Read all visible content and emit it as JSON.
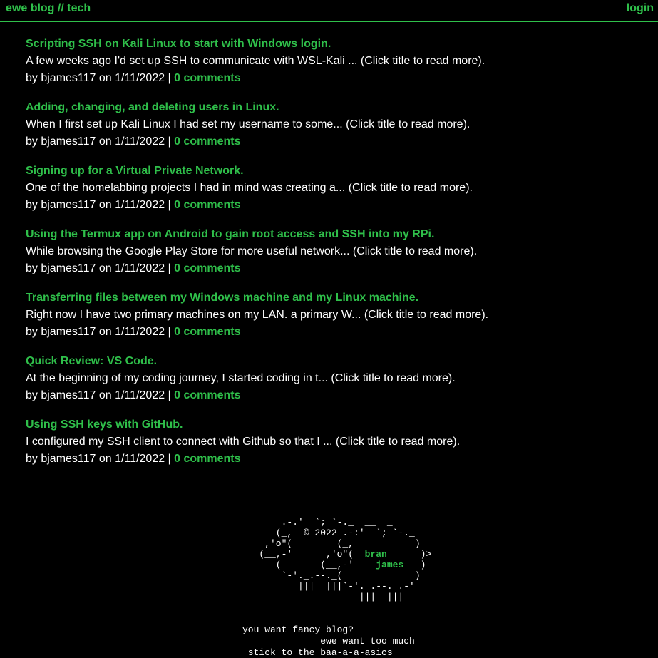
{
  "header": {
    "site_title": "ewe blog // tech",
    "login_label": "login"
  },
  "posts": [
    {
      "title": "Scripting SSH on Kali Linux to start with Windows login.",
      "excerpt": "A few weeks ago I'd set up SSH to communicate with WSL-Kali ... (Click title to read more).",
      "meta": "by bjames117 on 1/11/2022 | ",
      "comments": "0 comments"
    },
    {
      "title": "Adding, changing, and deleting users in Linux.",
      "excerpt": "When I first set up Kali Linux I had set my username to some... (Click title to read more).",
      "meta": "by bjames117 on 1/11/2022 | ",
      "comments": "0 comments"
    },
    {
      "title": "Signing up for a Virtual Private Network.",
      "excerpt": "One of the homelabbing projects I had in mind was creating a... (Click title to read more).",
      "meta": "by bjames117 on 1/11/2022 | ",
      "comments": "0 comments"
    },
    {
      "title": "Using the Termux app on Android to gain root access and SSH into my RPi.",
      "excerpt": "While browsing the Google Play Store for more useful network... (Click title to read more).",
      "meta": "by bjames117 on 1/11/2022 | ",
      "comments": "0 comments"
    },
    {
      "title": "Transferring files between my Windows machine and my Linux machine.",
      "excerpt": "Right now I have two primary machines on my LAN. a primary W... (Click title to read more).",
      "meta": "by bjames117 on 1/11/2022 | ",
      "comments": "0 comments"
    },
    {
      "title": "Quick Review: VS Code.",
      "excerpt": "At the beginning of my coding journey, I started coding in t... (Click title to read more).",
      "meta": "by bjames117 on 1/11/2022 | ",
      "comments": "0 comments"
    },
    {
      "title": "Using SSH keys with GitHub.",
      "excerpt": "I configured my SSH client to connect with Github so that I ... (Click title to read more).",
      "meta": "by bjames117 on 1/11/2022 | ",
      "comments": "0 comments"
    }
  ],
  "footer": {
    "ascii_lines": [
      "           __  _",
      "       .-.'  `; `-._  __  _",
      "      (_,  © 2022 .-:'  `; `-._",
      "    ,'o\"(        (_,           )",
      "   (__,-'      ,'o\"(  ",
      "      (       (__,-'    ",
      "       `-'._.--._(             )",
      "          |||  |||`-'._.--._.-'",
      "                     |||  |||"
    ],
    "ascii_name_first": "bran",
    "ascii_name_last": "james",
    "ascii_line5_tail": "      )>",
    "ascii_line6_tail": "   )",
    "verse": [
      "you want fancy blog?",
      "              ewe want too much",
      " stick to the baa-a-a-asics"
    ]
  },
  "colors": {
    "accent": "#2fbf4a",
    "background": "#000000",
    "text": "#ffffff"
  }
}
